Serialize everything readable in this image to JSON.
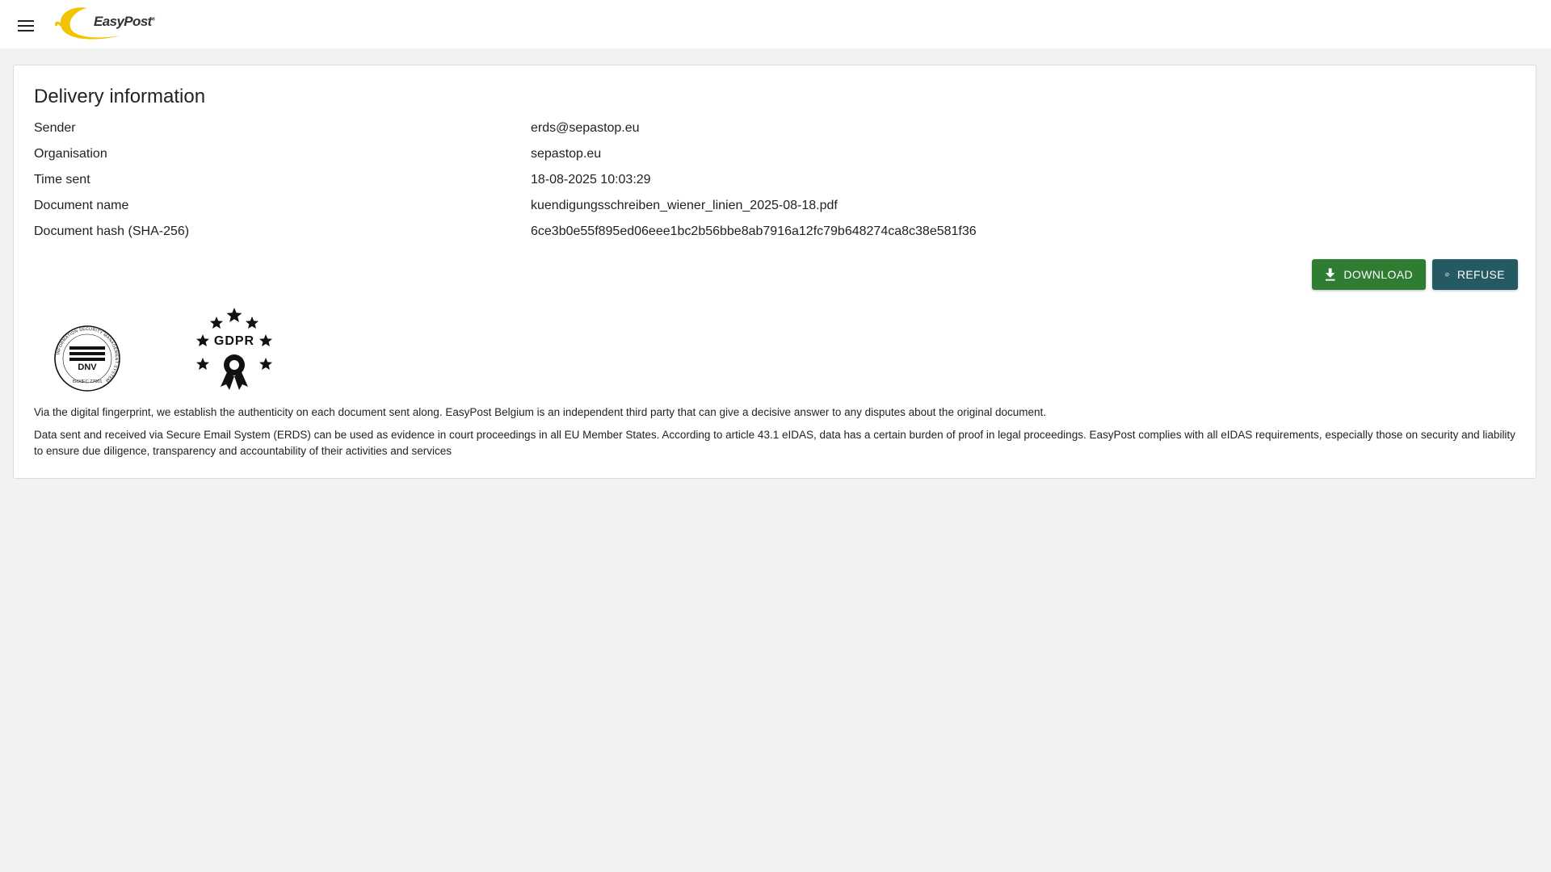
{
  "header": {
    "menu_icon": "menu-icon",
    "logo_text": "EasyPost",
    "logo_mark": "®"
  },
  "delivery": {
    "title": "Delivery information",
    "rows": [
      {
        "label": "Sender",
        "value": "erds@sepastop.eu"
      },
      {
        "label": "Organisation",
        "value": "sepastop.eu"
      },
      {
        "label": "Time sent",
        "value": "18-08-2025 10:03:29"
      },
      {
        "label": "Document name",
        "value": "kuendigungsschreiben_wiener_linien_2025-08-18.pdf"
      },
      {
        "label": "Document hash (SHA-256)",
        "value": "6ce3b0e55f895ed06eee1bc2b56bbe8ab7916a12fc79b648274ca8c38e581f36"
      }
    ]
  },
  "actions": {
    "download_label": "DOWNLOAD",
    "download_icon": "download-icon",
    "refuse_label": "REFUSE",
    "refuse_icon": "block-icon"
  },
  "badges": {
    "dnv_ring_text": "INFORMATION SECURITY MANAGEMENT SYSTEM",
    "dnv_name": "DNV",
    "dnv_standard": "ISO/IEC 27001",
    "gdpr_text": "GDPR"
  },
  "footer_text": {
    "p1": "Via the digital fingerprint, we establish the authenticity on each document sent along. EasyPost Belgium is an independent third party that can give a decisive answer to any disputes about the original document.",
    "p2": "Data sent and received via Secure Email System (ERDS) can be used as evidence in court proceedings in all EU Member States. According to article 43.1 eIDAS, data has a certain burden of proof in legal proceedings. EasyPost complies with all eIDAS requirements, especially those on security and liability to ensure due diligence, transparency and accountability of their activities and services"
  },
  "colors": {
    "download": "#2e7d32",
    "refuse": "#255a63",
    "logo_accent": "#f2c300",
    "background": "#f2f2f2"
  }
}
